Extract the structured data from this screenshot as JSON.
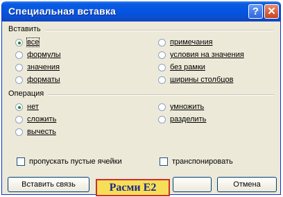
{
  "window": {
    "title": "Специальная вставка",
    "help_glyph": "?",
    "close_glyph": "✕"
  },
  "paste_group": {
    "label": "Вставить",
    "options": [
      {
        "label": "все",
        "checked": true
      },
      {
        "label": "формулы",
        "checked": false
      },
      {
        "label": "значения",
        "checked": false
      },
      {
        "label": "форматы",
        "checked": false
      },
      {
        "label": "примечания",
        "checked": false
      },
      {
        "label": "условия на значения",
        "checked": false
      },
      {
        "label": "без рамки",
        "checked": false
      },
      {
        "label": "ширины столбцов",
        "checked": false
      }
    ]
  },
  "operation_group": {
    "label": "Операция",
    "options": [
      {
        "label": "нет",
        "checked": true
      },
      {
        "label": "сложить",
        "checked": false
      },
      {
        "label": "вычесть",
        "checked": false
      },
      {
        "label": "умножить",
        "checked": false
      },
      {
        "label": "разделить",
        "checked": false
      }
    ]
  },
  "checkboxes": {
    "skip_blanks": "пропускать пустые ячейки",
    "transpose": "транспонировать"
  },
  "buttons": {
    "paste_link": "Вставить связь",
    "cancel": "Отмена"
  },
  "caption": "Расми Е2",
  "colors": {
    "titlebar": "#0554e3",
    "dialog_bg": "#ece9d8",
    "caption_bg": "#f7de58",
    "caption_border": "#c9302c",
    "caption_text": "#1b2a8a"
  }
}
